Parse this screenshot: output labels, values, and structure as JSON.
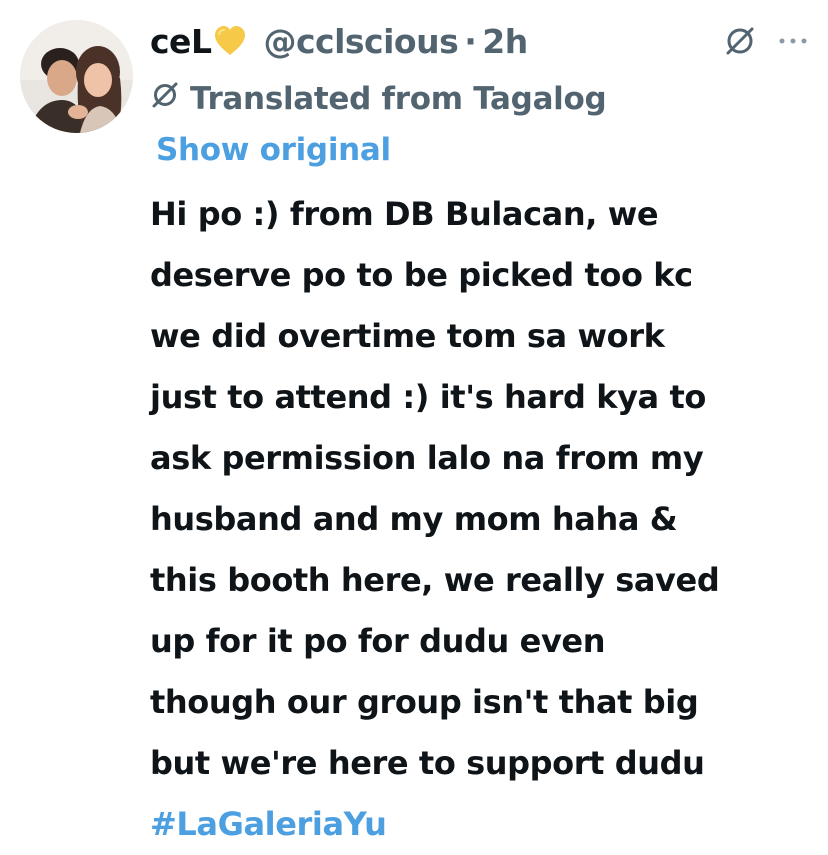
{
  "author": {
    "display_name": "ceL",
    "emoji": "yellow-heart",
    "handle": "@cclscious",
    "separator": "·",
    "time": "2h"
  },
  "header_actions": {
    "icons": [
      "translate-icon",
      "more-icon"
    ]
  },
  "translation": {
    "label": "Translated from Tagalog",
    "show_original": "Show original"
  },
  "tweet": {
    "lines": [
      "Hi po :) from DB Bulacan, we",
      "deserve po to be picked too kc",
      "we did overtime tom sa work",
      "just to attend :) it's hard kya to",
      "ask permission lalo na from my",
      "husband and my mom haha &",
      "this booth here, we really saved",
      "up for it po for dudu even",
      "though our group isn't that big",
      "but we're here to support dudu"
    ],
    "hashtag": "#LaGaleriaYu"
  },
  "colors": {
    "text": "#0f1419",
    "secondary": "#536471",
    "link": "#4c9fe0",
    "heart": "#f7c948"
  }
}
